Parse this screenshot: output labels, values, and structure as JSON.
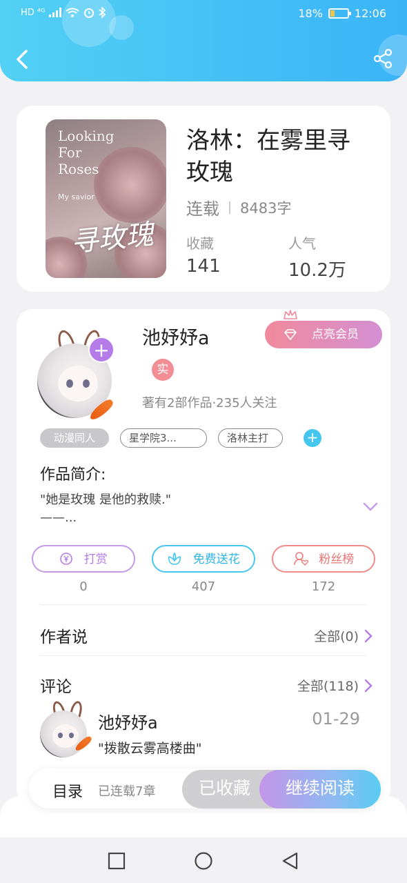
{
  "status_bar": {
    "left_label": "HD ⁴ᴳ",
    "battery_percent": "18%",
    "time": "12:06"
  },
  "book": {
    "cover_title_en": "Looking\nFor\nRoses",
    "cover_subtitle": "My savior",
    "cover_title_cn": "寻玫瑰",
    "title": "洛林：在雾里寻玫瑰",
    "status": "连载",
    "word_count": "8483字",
    "stats": [
      {
        "label": "收藏",
        "value": "141"
      },
      {
        "label": "人气",
        "value": "10.2万"
      }
    ]
  },
  "author": {
    "name": "池妤妤a",
    "real_badge": "实",
    "vip_button": "点亮会员",
    "summary": "著有2部作品·235人关注",
    "tags": [
      "动漫同人",
      "星学院3...",
      "洛林主打"
    ],
    "intro_title": "作品简介:",
    "intro_text": "\"她是玫瑰 是他的救赎.\"\n——..."
  },
  "actions": [
    {
      "label": "打赏",
      "count": "0",
      "color": "#b57be8"
    },
    {
      "label": "免费送花",
      "count": "407",
      "color": "#46c6ee"
    },
    {
      "label": "粉丝榜",
      "count": "172",
      "color": "#ef7b7b"
    }
  ],
  "author_says": {
    "title": "作者说",
    "link": "全部(0)"
  },
  "comments": {
    "title": "评论",
    "link": "全部(118)",
    "items": [
      {
        "user": "池妤妤a",
        "date": "01-29",
        "text": "\"拨散云雾高楼曲\""
      }
    ]
  },
  "bottom_bar": {
    "toc_label": "目录",
    "toc_sub": "已连载7章",
    "collected_label": "已收藏",
    "read_label": "继续阅读"
  },
  "colors": {
    "header_start": "#52d0f5",
    "header_end": "#3bb4f6",
    "accent_purple": "#b57be8",
    "accent_blue": "#46c6ee",
    "accent_red": "#ef7b7b"
  }
}
